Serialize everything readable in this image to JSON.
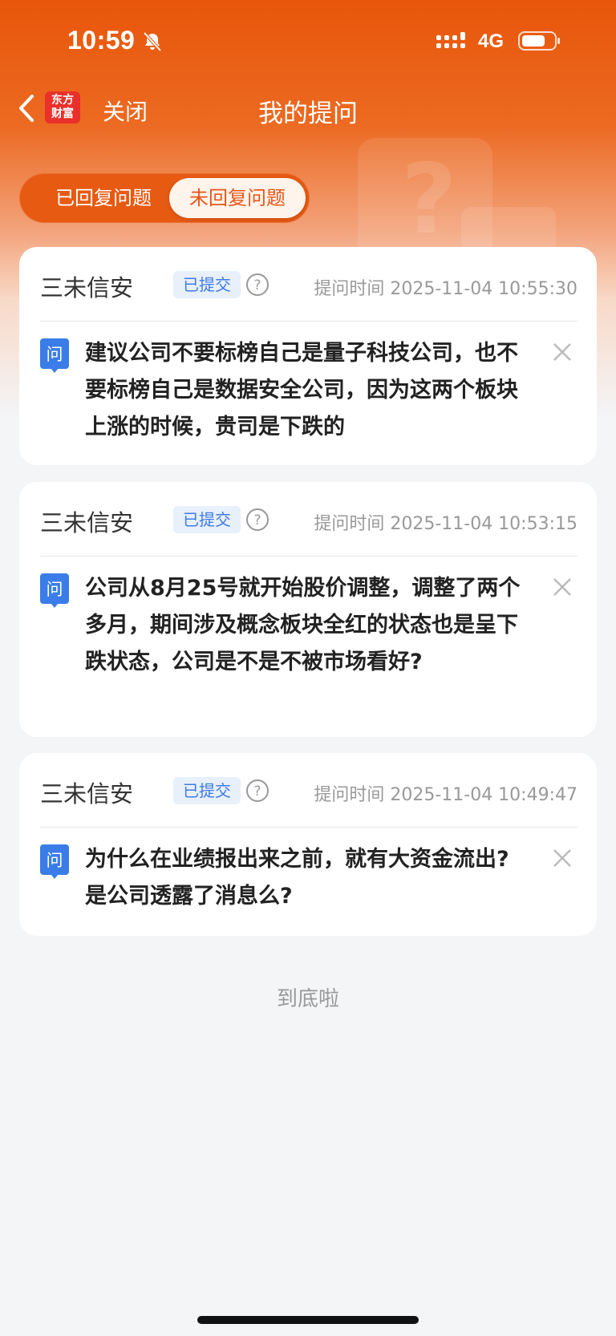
{
  "status_bar": {
    "time": "10:59",
    "network": "4G",
    "icons": [
      "bell-off-icon",
      "signal-icon",
      "battery-icon"
    ]
  },
  "nav": {
    "back_icon": "chevron-left-icon",
    "logo_line1": "东方",
    "logo_line2": "财富",
    "close_label": "关闭",
    "title": "我的提问"
  },
  "tabs": [
    {
      "label": "已回复问题",
      "active": false
    },
    {
      "label": "未回复问题",
      "active": true
    }
  ],
  "questions": [
    {
      "company": "三未信安",
      "status": "已提交",
      "time_label": "提问时间 2025-11-04 10:55:30",
      "q_icon_label": "问",
      "text": "建议公司不要标榜自己是量子科技公司，也不要标榜自己是数据安全公司，因为这两个板块上涨的时候，贵司是下跌的"
    },
    {
      "company": "三未信安",
      "status": "已提交",
      "time_label": "提问时间 2025-11-04 10:53:15",
      "q_icon_label": "问",
      "text": "公司从8月25号就开始股价调整，调整了两个多月，期间涉及概念板块全红的状态也是呈下跌状态，公司是不是不被市场看好?"
    },
    {
      "company": "三未信安",
      "status": "已提交",
      "time_label": "提问时间 2025-11-04 10:49:47",
      "q_icon_label": "问",
      "text": "为什么在业绩报出来之前，就有大资金流出? 是公司透露了消息么?"
    }
  ],
  "footer": {
    "end_text": "到底啦"
  },
  "colors": {
    "brand_orange": "#e8560a",
    "badge_blue": "#3e7be6",
    "text_dark": "#222222",
    "text_muted": "#999999"
  }
}
